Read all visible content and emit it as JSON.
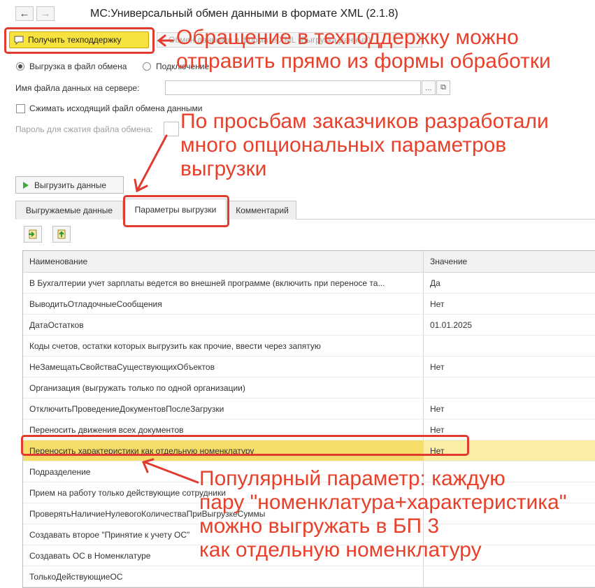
{
  "window": {
    "title": "МС:Универсальный обмен данными в формате XML (2.1.8)",
    "back_icon": "arrow-left-icon",
    "forward_icon": "arrow-right-icon"
  },
  "toolbar": {
    "support_label": "Получить техподдержку",
    "ghost_label": "Обмен данными в формате XML (Выгрузка данных)"
  },
  "mode": {
    "export_label": "Выгрузка в файл обмена",
    "import_label": "Подключение"
  },
  "form": {
    "server_file_label": "Имя файла данных на сервере:",
    "server_file_value": "",
    "select_button": "...",
    "open_button": "⧉",
    "compress_label": "Сжимать исходящий файл обмена данными",
    "password_label": "Пароль для сжатия файла обмена:",
    "password_value": ""
  },
  "export_button": "Выгрузить данные",
  "tabs": [
    {
      "label": "Выгружаемые данные"
    },
    {
      "label": "Параметры выгрузки"
    },
    {
      "label": "Комментарий"
    }
  ],
  "table": {
    "headers": {
      "name": "Наименование",
      "value": "Значение"
    },
    "rows": [
      {
        "name": "В Бухгалтерии учет зарплаты ведется во внешней программе (включить при переносе та...",
        "value": "Да"
      },
      {
        "name": "ВыводитьОтладочныеСообщения",
        "value": "Нет"
      },
      {
        "name": "ДатаОстатков",
        "value": "01.01.2025"
      },
      {
        "name": "Коды счетов, остатки которых выгрузить как прочие, ввести через запятую",
        "value": ""
      },
      {
        "name": "НеЗамещатьСвойстваСуществующихОбъектов",
        "value": "Нет"
      },
      {
        "name": "Организация (выгружать только по одной организации)",
        "value": ""
      },
      {
        "name": "ОтключитьПроведениеДокументовПослеЗагрузки",
        "value": "Нет"
      },
      {
        "name": "Переносить движения всех документов",
        "value": "Нет"
      },
      {
        "name": "Переносить характеристики как отдельную номенклатуру",
        "value": "Нет"
      },
      {
        "name": "Подразделение",
        "value": ""
      },
      {
        "name": "Прием на работу только действующие сотрудники",
        "value": ""
      },
      {
        "name": "ПроверятьНаличиеНулевогоКоличестваПриВыгрузкеСуммы",
        "value": ""
      },
      {
        "name": "Создавать второе \"Принятие к учету ОС\"",
        "value": ""
      },
      {
        "name": "Создавать ОС в Номенклатуре",
        "value": ""
      },
      {
        "name": "ТолькоДействующиеОС",
        "value": ""
      }
    ]
  },
  "annotations": {
    "support": [
      "Обращение в техподдержку можно",
      "отправить прямо из формы обработки"
    ],
    "params": [
      "По просьбам заказчиков разработали",
      "много опциональных параметров",
      "выгрузки"
    ],
    "popular": [
      "Популярный параметр: каждую",
      "пару \"номенклатура+характеристика\"",
      "можно выгружать в БП 3",
      "как отдельную номенклатуру"
    ]
  },
  "colors": {
    "accent_yellow": "#f8e23d",
    "annotation_red": "#e8402a",
    "selected_row": "#fbeea4"
  }
}
